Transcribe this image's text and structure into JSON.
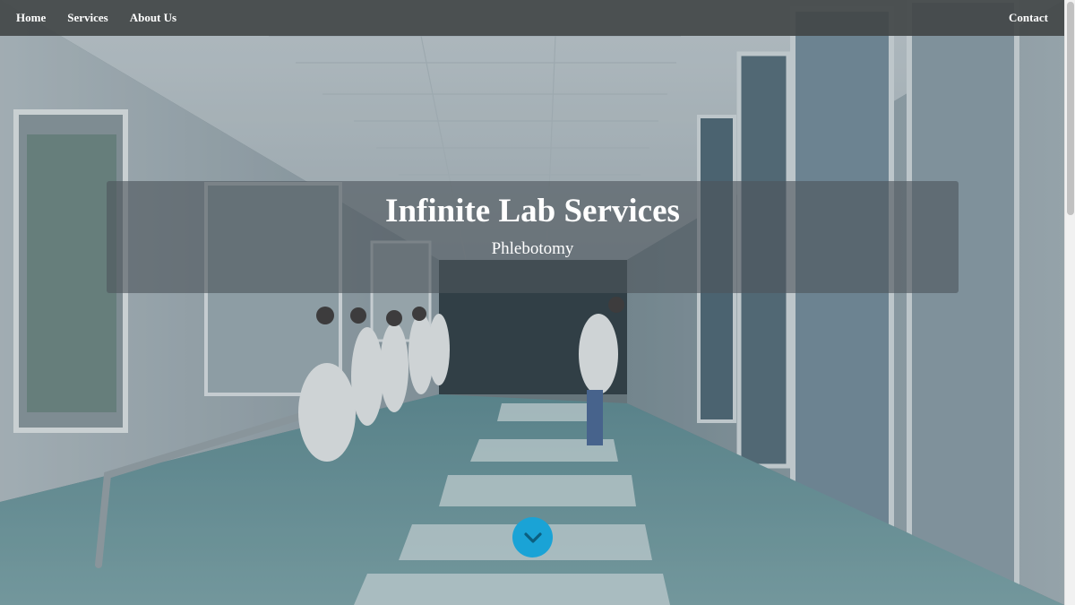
{
  "nav": {
    "left_links": [
      {
        "label": "Home"
      },
      {
        "label": "Services"
      },
      {
        "label": "About Us"
      }
    ],
    "right_link": {
      "label": "Contact"
    }
  },
  "hero": {
    "title": "Infinite Lab Services",
    "subtitle": "Phlebotomy",
    "scroll_icon": "chevron-down-icon"
  },
  "colors": {
    "nav_bg": "#424648",
    "scroll_button": "#1aa3d6",
    "text": "#ffffff"
  }
}
